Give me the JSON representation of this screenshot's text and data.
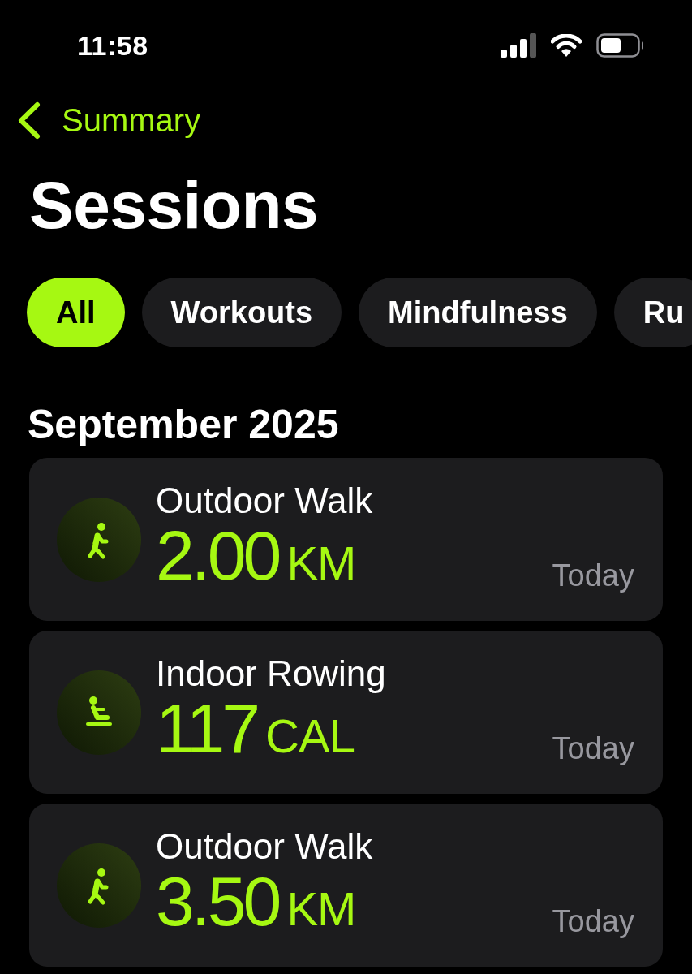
{
  "status_bar": {
    "time": "11:58"
  },
  "nav": {
    "back_label": "Summary"
  },
  "title": "Sessions",
  "filters": [
    {
      "label": "All",
      "selected": true
    },
    {
      "label": "Workouts",
      "selected": false
    },
    {
      "label": "Mindfulness",
      "selected": false
    },
    {
      "label": "Ru",
      "selected": false
    }
  ],
  "sections": [
    {
      "title": "September 2025",
      "sessions": [
        {
          "kind": "walk",
          "name": "Outdoor Walk",
          "value": "2.00",
          "unit": "KM",
          "date": "Today"
        },
        {
          "kind": "rowing",
          "name": "Indoor Rowing",
          "value": "117",
          "unit": "CAL",
          "date": "Today"
        },
        {
          "kind": "walk",
          "name": "Outdoor Walk",
          "value": "3.50",
          "unit": "KM",
          "date": "Today"
        }
      ]
    }
  ]
}
